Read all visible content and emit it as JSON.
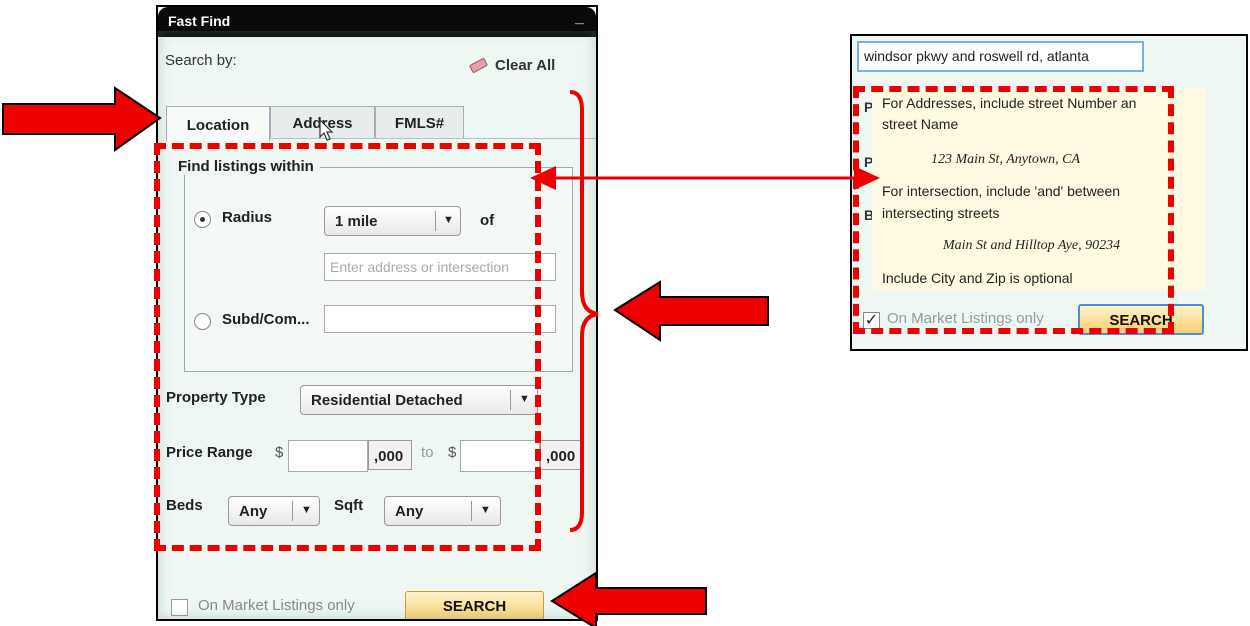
{
  "panel": {
    "title": "Fast Find",
    "minimize_icon": "_",
    "search_by_label": "Search by:",
    "clear_all_label": "Clear All",
    "tabs": [
      {
        "label": "Location",
        "active": true
      },
      {
        "label": "Address",
        "active": false
      },
      {
        "label": "FMLS#",
        "active": false
      }
    ],
    "find_within_legend": "Find listings within",
    "radius": {
      "label": "Radius",
      "checked": true,
      "selected_value": "1 mile",
      "of_label": "of",
      "address_placeholder": "Enter address or intersection"
    },
    "subdivision": {
      "label": "Subd/Com...",
      "checked": false,
      "value": ""
    },
    "property_type": {
      "label": "Property Type",
      "selected_value": "Residential Detached"
    },
    "price_range": {
      "label": "Price Range",
      "currency": "$",
      "thousands_suffix": ",000",
      "to_label": "to",
      "min_value": "",
      "max_value": ""
    },
    "beds": {
      "label": "Beds",
      "selected_value": "Any"
    },
    "sqft": {
      "label": "Sqft",
      "selected_value": "Any"
    },
    "on_market_label": "On Market Listings only",
    "on_market_checked": false,
    "search_button": "SEARCH"
  },
  "address_panel": {
    "input_value": "windsor pkwy and roswell rd, atlanta",
    "behind_letters": [
      "P",
      "P",
      "B"
    ],
    "tooltip": {
      "line1": "For Addresses, include street Number an",
      "line2": "street Name",
      "example1": "123 Main St, Anytown, CA",
      "line3": "For intersection, include 'and' between",
      "line4": "intersecting streets",
      "example2": "Main St and Hilltop Aye, 90234",
      "line5": "Include City and Zip is optional"
    },
    "on_market_label": "On Market Listings only",
    "on_market_checked": true,
    "check_glyph": "✓",
    "search_button": "SEARCH"
  },
  "annotations": {
    "color": "#ee0000",
    "arrow_icons": [
      "right-arrow-icon",
      "left-arrow-icon",
      "double-headed-arrow-icon",
      "curly-brace-icon"
    ]
  },
  "icons": {
    "dropdown_arrow": "▼",
    "eraser": "eraser-icon",
    "cursor": "pointer-cursor-icon"
  }
}
